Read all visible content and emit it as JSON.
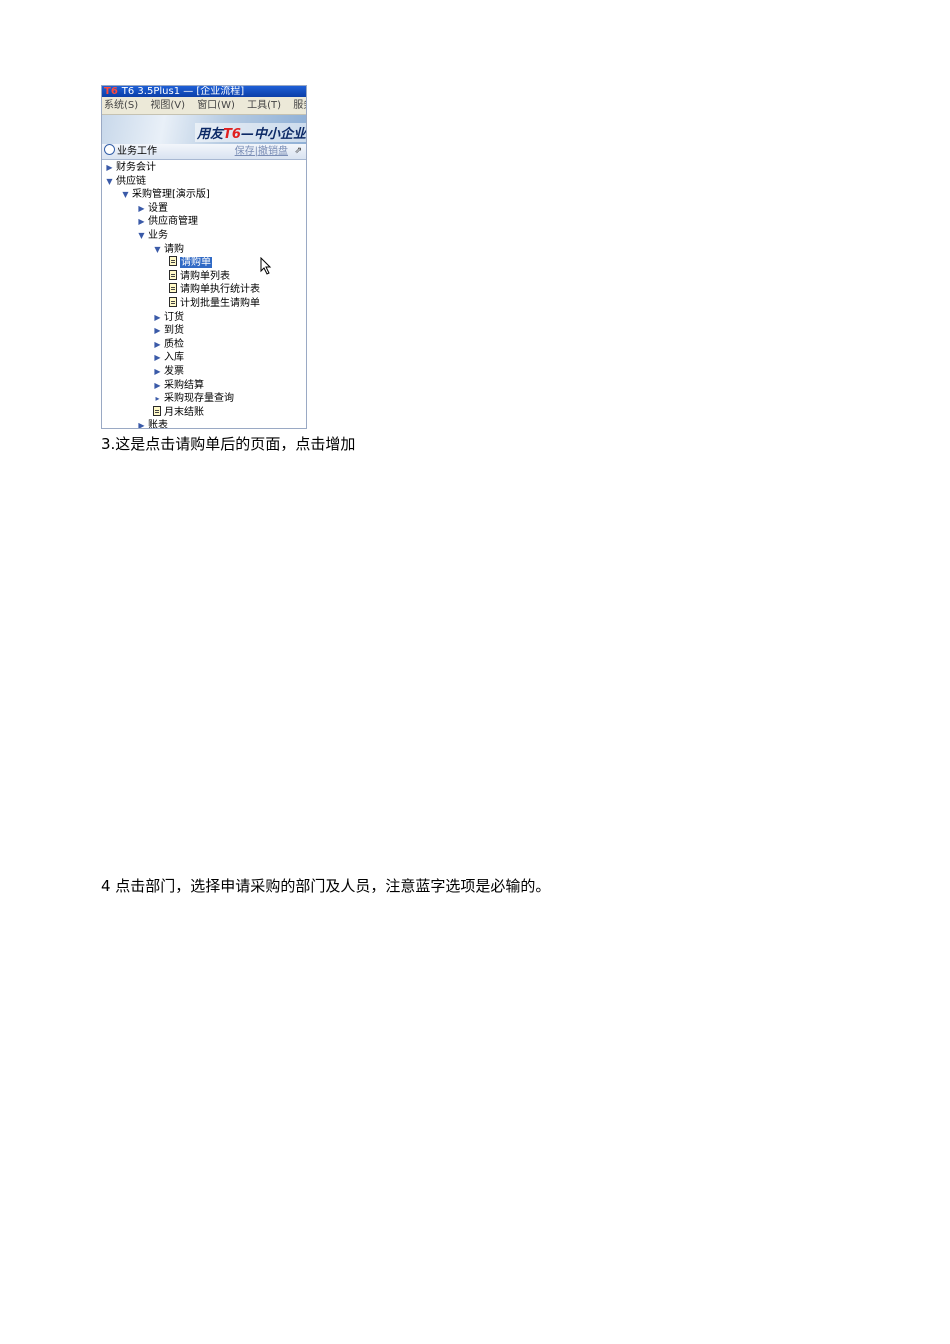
{
  "screenshot": {
    "title": "T6 3.5Plus1 — [企业流程]",
    "logo_text": "T6",
    "menu": [
      "系统(S)",
      "视图(V)",
      "窗口(W)",
      "工具(T)",
      "服务"
    ],
    "banner_prefix": "用友",
    "banner_highlight": "T6",
    "banner_suffix": "—中小企业",
    "panel_title": "业务工作",
    "panel_links": "保存|撤销盘",
    "panel_pin": "⇗",
    "tree": [
      {
        "label": "财务会计",
        "level": 0,
        "icon": "expand-arrow"
      },
      {
        "label": "供应链",
        "level": 0,
        "icon": "collapse-arrow"
      },
      {
        "label": "采购管理[演示版]",
        "level": 1,
        "icon": "collapse-arrow"
      },
      {
        "label": "设置",
        "level": 2,
        "icon": "expand-arrow"
      },
      {
        "label": "供应商管理",
        "level": 2,
        "icon": "expand-arrow"
      },
      {
        "label": "业务",
        "level": 2,
        "icon": "collapse-arrow"
      },
      {
        "label": "请购",
        "level": 3,
        "icon": "collapse-arrow"
      },
      {
        "label": "请购单",
        "level": 4,
        "icon": "document",
        "selected": true
      },
      {
        "label": "请购单列表",
        "level": 4,
        "icon": "document"
      },
      {
        "label": "请购单执行统计表",
        "level": 4,
        "icon": "document"
      },
      {
        "label": "计划批量生请购单",
        "level": 4,
        "icon": "document"
      },
      {
        "label": "订货",
        "level": 3,
        "icon": "expand-arrow"
      },
      {
        "label": "到货",
        "level": 3,
        "icon": "expand-arrow"
      },
      {
        "label": "质检",
        "level": 3,
        "icon": "expand-arrow"
      },
      {
        "label": "入库",
        "level": 3,
        "icon": "expand-arrow"
      },
      {
        "label": "发票",
        "level": 3,
        "icon": "expand-arrow"
      },
      {
        "label": "采购结算",
        "level": 3,
        "icon": "expand-arrow"
      },
      {
        "label": "采购现存量查询",
        "level": 3,
        "icon": "small-arrow"
      },
      {
        "label": "月末结账",
        "level": 3,
        "icon": "document"
      },
      {
        "label": "账表",
        "level": 2,
        "icon": "expand-arrow"
      }
    ]
  },
  "paragraphs": [
    "3.这是点击请购单后的页面，点击增加",
    "4 点击部门，选择申请采购的部门及人员，注意蓝字选项是必输的。"
  ]
}
